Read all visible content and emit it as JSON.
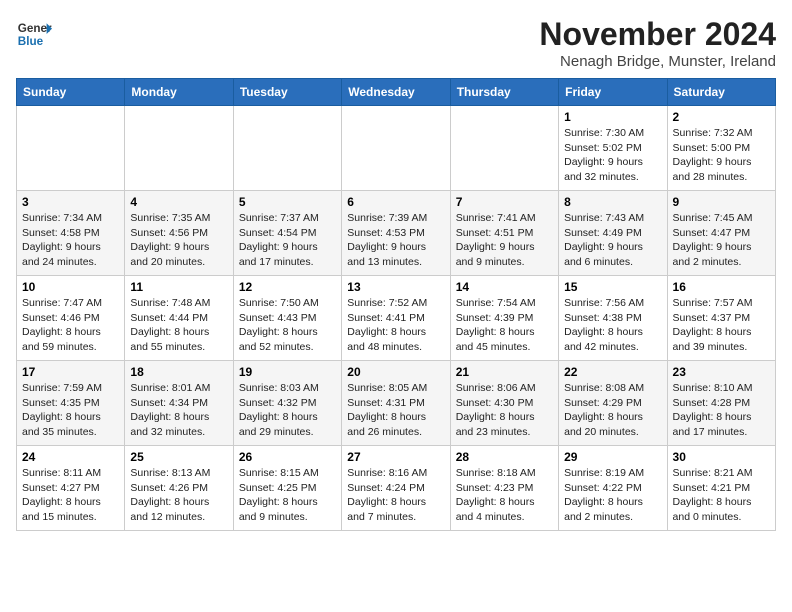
{
  "logo": {
    "general": "General",
    "blue": "Blue"
  },
  "header": {
    "month": "November 2024",
    "location": "Nenagh Bridge, Munster, Ireland"
  },
  "days_of_week": [
    "Sunday",
    "Monday",
    "Tuesday",
    "Wednesday",
    "Thursday",
    "Friday",
    "Saturday"
  ],
  "weeks": [
    [
      {
        "day": "",
        "info": ""
      },
      {
        "day": "",
        "info": ""
      },
      {
        "day": "",
        "info": ""
      },
      {
        "day": "",
        "info": ""
      },
      {
        "day": "",
        "info": ""
      },
      {
        "day": "1",
        "info": "Sunrise: 7:30 AM\nSunset: 5:02 PM\nDaylight: 9 hours and 32 minutes."
      },
      {
        "day": "2",
        "info": "Sunrise: 7:32 AM\nSunset: 5:00 PM\nDaylight: 9 hours and 28 minutes."
      }
    ],
    [
      {
        "day": "3",
        "info": "Sunrise: 7:34 AM\nSunset: 4:58 PM\nDaylight: 9 hours and 24 minutes."
      },
      {
        "day": "4",
        "info": "Sunrise: 7:35 AM\nSunset: 4:56 PM\nDaylight: 9 hours and 20 minutes."
      },
      {
        "day": "5",
        "info": "Sunrise: 7:37 AM\nSunset: 4:54 PM\nDaylight: 9 hours and 17 minutes."
      },
      {
        "day": "6",
        "info": "Sunrise: 7:39 AM\nSunset: 4:53 PM\nDaylight: 9 hours and 13 minutes."
      },
      {
        "day": "7",
        "info": "Sunrise: 7:41 AM\nSunset: 4:51 PM\nDaylight: 9 hours and 9 minutes."
      },
      {
        "day": "8",
        "info": "Sunrise: 7:43 AM\nSunset: 4:49 PM\nDaylight: 9 hours and 6 minutes."
      },
      {
        "day": "9",
        "info": "Sunrise: 7:45 AM\nSunset: 4:47 PM\nDaylight: 9 hours and 2 minutes."
      }
    ],
    [
      {
        "day": "10",
        "info": "Sunrise: 7:47 AM\nSunset: 4:46 PM\nDaylight: 8 hours and 59 minutes."
      },
      {
        "day": "11",
        "info": "Sunrise: 7:48 AM\nSunset: 4:44 PM\nDaylight: 8 hours and 55 minutes."
      },
      {
        "day": "12",
        "info": "Sunrise: 7:50 AM\nSunset: 4:43 PM\nDaylight: 8 hours and 52 minutes."
      },
      {
        "day": "13",
        "info": "Sunrise: 7:52 AM\nSunset: 4:41 PM\nDaylight: 8 hours and 48 minutes."
      },
      {
        "day": "14",
        "info": "Sunrise: 7:54 AM\nSunset: 4:39 PM\nDaylight: 8 hours and 45 minutes."
      },
      {
        "day": "15",
        "info": "Sunrise: 7:56 AM\nSunset: 4:38 PM\nDaylight: 8 hours and 42 minutes."
      },
      {
        "day": "16",
        "info": "Sunrise: 7:57 AM\nSunset: 4:37 PM\nDaylight: 8 hours and 39 minutes."
      }
    ],
    [
      {
        "day": "17",
        "info": "Sunrise: 7:59 AM\nSunset: 4:35 PM\nDaylight: 8 hours and 35 minutes."
      },
      {
        "day": "18",
        "info": "Sunrise: 8:01 AM\nSunset: 4:34 PM\nDaylight: 8 hours and 32 minutes."
      },
      {
        "day": "19",
        "info": "Sunrise: 8:03 AM\nSunset: 4:32 PM\nDaylight: 8 hours and 29 minutes."
      },
      {
        "day": "20",
        "info": "Sunrise: 8:05 AM\nSunset: 4:31 PM\nDaylight: 8 hours and 26 minutes."
      },
      {
        "day": "21",
        "info": "Sunrise: 8:06 AM\nSunset: 4:30 PM\nDaylight: 8 hours and 23 minutes."
      },
      {
        "day": "22",
        "info": "Sunrise: 8:08 AM\nSunset: 4:29 PM\nDaylight: 8 hours and 20 minutes."
      },
      {
        "day": "23",
        "info": "Sunrise: 8:10 AM\nSunset: 4:28 PM\nDaylight: 8 hours and 17 minutes."
      }
    ],
    [
      {
        "day": "24",
        "info": "Sunrise: 8:11 AM\nSunset: 4:27 PM\nDaylight: 8 hours and 15 minutes."
      },
      {
        "day": "25",
        "info": "Sunrise: 8:13 AM\nSunset: 4:26 PM\nDaylight: 8 hours and 12 minutes."
      },
      {
        "day": "26",
        "info": "Sunrise: 8:15 AM\nSunset: 4:25 PM\nDaylight: 8 hours and 9 minutes."
      },
      {
        "day": "27",
        "info": "Sunrise: 8:16 AM\nSunset: 4:24 PM\nDaylight: 8 hours and 7 minutes."
      },
      {
        "day": "28",
        "info": "Sunrise: 8:18 AM\nSunset: 4:23 PM\nDaylight: 8 hours and 4 minutes."
      },
      {
        "day": "29",
        "info": "Sunrise: 8:19 AM\nSunset: 4:22 PM\nDaylight: 8 hours and 2 minutes."
      },
      {
        "day": "30",
        "info": "Sunrise: 8:21 AM\nSunset: 4:21 PM\nDaylight: 8 hours and 0 minutes."
      }
    ]
  ]
}
